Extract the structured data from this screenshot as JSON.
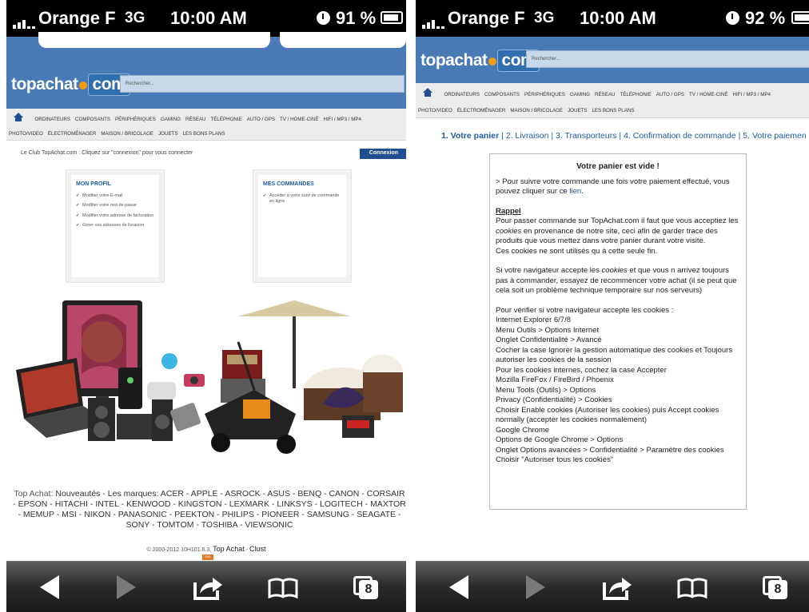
{
  "left": {
    "status": {
      "carrier": "Orange F",
      "network": "3G",
      "time": "10:00 AM",
      "battery": "91 %"
    },
    "header": {
      "logo_text": "topachat",
      "logo_com": "com",
      "search_placeholder": "Rechercher..."
    },
    "nav": {
      "row1": [
        "ORDINATEURS",
        "COMPOSANTS",
        "PÉRIPHÉRIQUES",
        "GAMING",
        "RÉSEAU",
        "TÉLÉPHONIE",
        "AUTO / GPS",
        "TV / HOME-CINÉ",
        "HIFI / MP3 / MP4"
      ],
      "row2": [
        "PHOTO/VIDEO",
        "ÉLECTROMÉNAGER",
        "MAISON / BRICOLAGE",
        "JOUETS",
        "LES BONS PLANS"
      ]
    },
    "club_text": "Le Club TopAchat.com : Cliquez sur \"connexion\" pour vous connecter",
    "connexion_label": "Connexion",
    "mon_profil": {
      "title": "MON PROFIL",
      "items": [
        "Modifier votre E-mail",
        "Modifier votre mot de passe",
        "Modifier votre adresse de facturation",
        "Gérer vos adresses de livraison"
      ]
    },
    "mes_commandes": {
      "title": "MES COMMANDES",
      "items": [
        "Accéder à votre suivi de commande en ligne"
      ]
    },
    "footer": {
      "top_achat_label": "Top Achat:",
      "nouveautes": "Nouveautés",
      "marques_label": "Les marques:",
      "brands": [
        "ACER",
        "APPLE",
        "ASROCK",
        "ASUS",
        "BENQ",
        "CANON",
        "CORSAIR",
        "EPSON",
        "HITACHI",
        "INTEL",
        "KENWOOD",
        "KINGSTON",
        "LEXMARK",
        "LINKSYS",
        "LOGITECH",
        "MAXTOR",
        "MEMUP",
        "MSI",
        "NIKON",
        "PANASONIC",
        "PEEKTON",
        "PHILIPS",
        "PIONEER",
        "SAMSUNG",
        "SEAGATE",
        "SONY",
        "TOMTOM",
        "TOSHIBA",
        "VIEWSONIC"
      ],
      "copyright": "© 2000-2012 10H101.6.3,",
      "copyright_link1": "Top Achat",
      "copyright_link2": "Clust",
      "badge": "XML"
    },
    "toolbar": {
      "tabs_count": "8"
    }
  },
  "right": {
    "status": {
      "carrier": "Orange F",
      "network": "3G",
      "time": "10:00 AM",
      "battery": "92 %"
    },
    "header": {
      "logo_text": "topachat",
      "logo_com": "com",
      "search_placeholder": "Rechercher..."
    },
    "nav": {
      "row1": [
        "ORDINATEURS",
        "COMPOSANTS",
        "PÉRIPHÉRIQUES",
        "GAMING",
        "RÉSEAU",
        "TÉLÉPHONIE",
        "AUTO / GPS",
        "TV / HOME-CINÉ",
        "HIFI / MP3 / MP4"
      ],
      "row2": [
        "PHOTO/VIDEO",
        "ÉLECTROMÉNAGER",
        "MAISON / BRICOLAGE",
        "JOUETS",
        "LES BONS PLANS"
      ]
    },
    "steps": [
      "1. Votre panier",
      "2. Livraison",
      "3. Transporteurs",
      "4. Confirmation de commande",
      "5. Votre paiemen"
    ],
    "cart": {
      "title": "Votre panier est vide !",
      "intro_before": "> Pour suivre votre commande une fois votre paiement effectué, vous pouvez cliquer sur ce ",
      "intro_link": "lien",
      "intro_after": ".",
      "rappel_title": "Rappel",
      "rappel_p1_a": "Pour passer commande sur TopAchat.com il faut que vous acceptiez les ",
      "rappel_p1_em": "cookies",
      "rappel_p1_b": " en provenance de notre site, ceci afin de garder trace des produits que vous mettez dans votre panier durant votre visite.",
      "rappel_p1_c": "Ces cookies ne sont utilisés qu à cette seule fin.",
      "p2_a": "Si votre navigateur accepte les ",
      "p2_em": "cookies",
      "p2_b": " et que vous n arrivez toujours pas à commander, essayez de recommencer votre achat (il se peut que cela soit un problème technique temporaire sur nos serveurs)",
      "instructions": [
        "Pour vérifier si votre navigateur accepte les cookies :",
        "Internet Explorer 6/7/8",
        "Menu Outils > Options Internet",
        "Onglet Confidentialité > Avancé",
        "Cocher la case Ignorer la gestion automatique des cookies et Toujours autoriser les cookies de la session",
        "Pour les cookies internes, cochez la case Accepter",
        "Mozilla FireFox / FireBird / Phoenix",
        "Menu Tools (Outils) > Options",
        "Privacy (Confidentialité) > Cookies",
        "Choisir Enable cookies (Autoriser les cookies) puis Accept cookies normally (accepter les cookies normalement)",
        "Google Chrome",
        "Options de Google Chrome > Options",
        "Onglet Options avancées > Confidentialité > Paramètre des cookies",
        "Choisir \"Autoriser tous les cookies\""
      ]
    },
    "toolbar": {
      "tabs_count": "8"
    }
  },
  "colors": {
    "header_blue": "#4a7ab6",
    "link_blue": "#1f5ca0",
    "nav_dark": "#1f4f91",
    "badge_orange": "#e07a24"
  }
}
